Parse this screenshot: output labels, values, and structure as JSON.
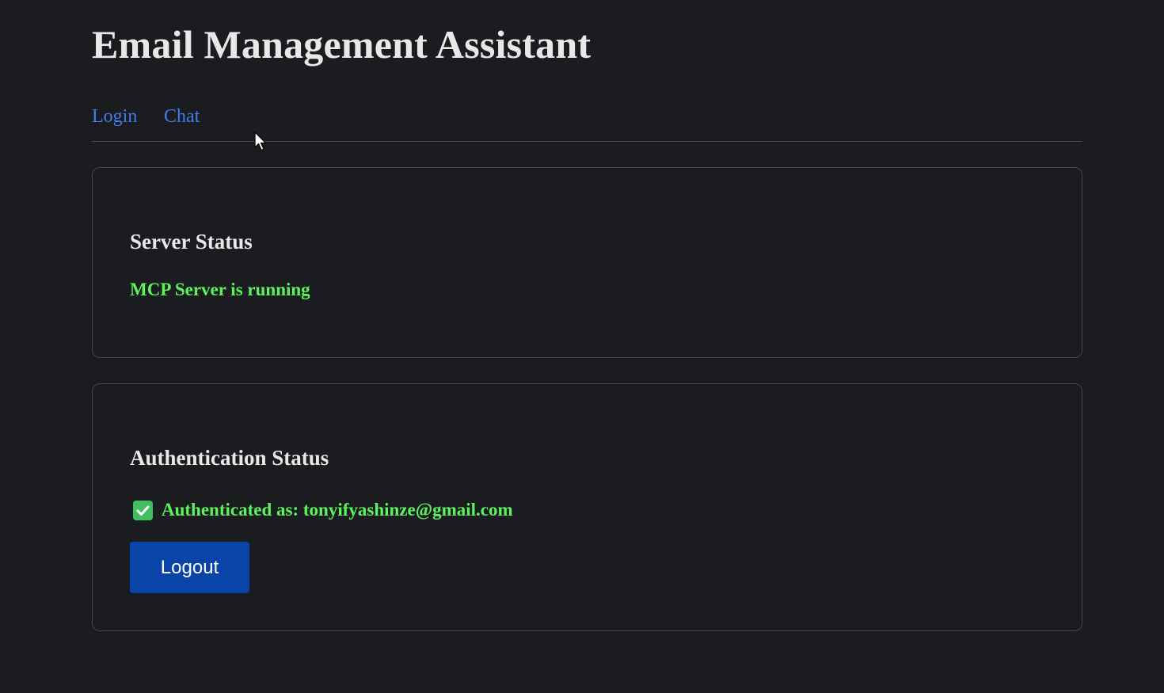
{
  "header": {
    "title": "Email Management Assistant"
  },
  "nav": {
    "items": [
      {
        "label": "Login"
      },
      {
        "label": "Chat"
      }
    ]
  },
  "server_status": {
    "heading": "Server Status",
    "message": "MCP Server is running"
  },
  "auth_status": {
    "heading": "Authentication Status",
    "message": "Authenticated as: tonyifyashinze@gmail.com",
    "logout_label": "Logout"
  },
  "colors": {
    "background": "#1b1c1f",
    "link": "#3f7cf0",
    "success": "#5cf35c",
    "button": "#0a44a8",
    "checkbox": "#3fbf60"
  },
  "icons": {
    "check": "check-mark-icon",
    "cursor": "mouse-pointer-icon"
  }
}
